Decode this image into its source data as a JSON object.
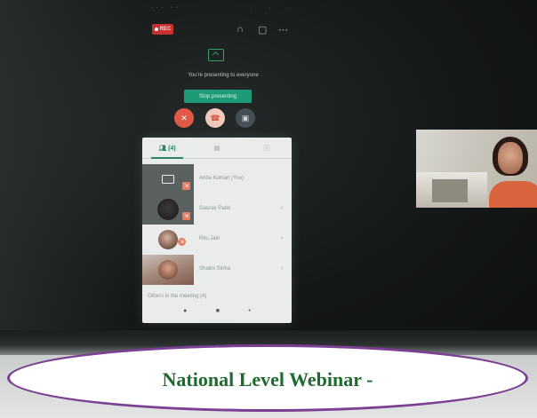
{
  "meeting": {
    "rec_label": "REC",
    "presenting_message": "You're presenting to everyone",
    "stop_presenting_label": "Stop presenting"
  },
  "people_panel": {
    "tabs": [
      {
        "label": "(4)",
        "icon": "people-icon"
      },
      {
        "label": "",
        "icon": "chat-icon"
      },
      {
        "label": "",
        "icon": "info-icon"
      }
    ],
    "participants": [
      {
        "name": "Anita Kumari (You)",
        "type": "screen-share"
      },
      {
        "name": "Gaurav Patel",
        "type": "avatar"
      },
      {
        "name": "Ritu Jain",
        "type": "photo"
      },
      {
        "name": "Shalini Sinha",
        "type": "photo"
      }
    ],
    "footer_label": "Others in the meeting (4)"
  },
  "self_video": {
    "name_label": ""
  },
  "caption": {
    "text": "National Level Webinar -"
  },
  "colors": {
    "accent_green": "#1e9a76",
    "record_red": "#c8302f",
    "caption_green": "#1f6a2f",
    "caption_border": "#7b3f93"
  }
}
